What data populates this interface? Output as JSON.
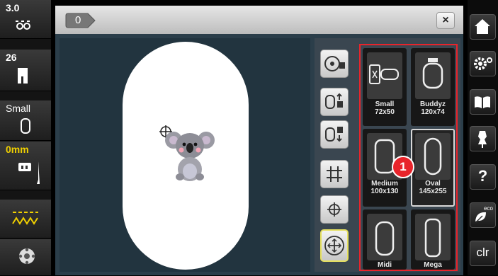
{
  "left_sidebar": {
    "stitch_width": "3.0",
    "stitch_length": "26",
    "hoop_label": "Small",
    "offset_value": "0mm"
  },
  "header": {
    "tab_label": "0",
    "close_label": "×"
  },
  "hoops": [
    {
      "name": "Small",
      "size": "72x50",
      "selected": false
    },
    {
      "name": "Buddyz",
      "size": "120x74",
      "selected": false
    },
    {
      "name": "Medium",
      "size": "100x130",
      "selected": false
    },
    {
      "name": "Oval",
      "size": "145x255",
      "selected": true
    },
    {
      "name": "Midi",
      "size": "",
      "selected": false
    },
    {
      "name": "Mega",
      "size": "",
      "selected": false
    }
  ],
  "callout_number": "1",
  "right_sidebar": {
    "help_label": "?",
    "eco_label": "eco",
    "clr_label": "clr"
  },
  "colors": {
    "highlight_red": "#e8242b",
    "selected_tool_yellow": "#e6e060",
    "accent_yellow": "#f0d000"
  }
}
